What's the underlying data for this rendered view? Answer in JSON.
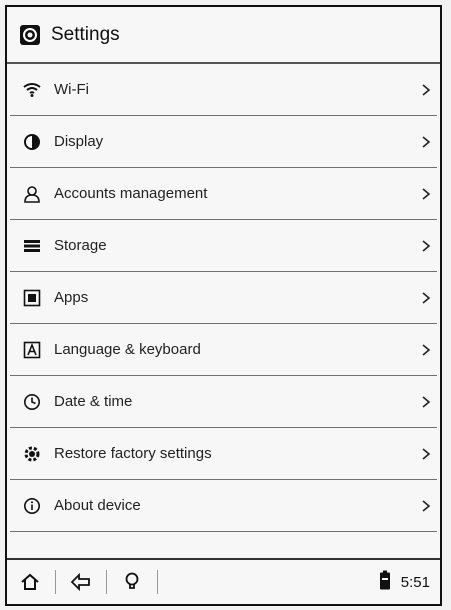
{
  "header": {
    "title": "Settings",
    "icon": "settings-app-icon"
  },
  "menu": [
    {
      "key": "wifi",
      "label": "Wi-Fi",
      "icon": "wifi-icon"
    },
    {
      "key": "display",
      "label": "Display",
      "icon": "contrast-icon"
    },
    {
      "key": "accounts",
      "label": "Accounts management",
      "icon": "user-icon"
    },
    {
      "key": "storage",
      "label": "Storage",
      "icon": "storage-icon"
    },
    {
      "key": "apps",
      "label": "Apps",
      "icon": "apps-icon"
    },
    {
      "key": "language",
      "label": "Language & keyboard",
      "icon": "keyboard-icon"
    },
    {
      "key": "datetime",
      "label": "Date & time",
      "icon": "clock-icon"
    },
    {
      "key": "restore",
      "label": "Restore factory settings",
      "icon": "restore-icon"
    },
    {
      "key": "about",
      "label": "About device",
      "icon": "info-icon"
    }
  ],
  "statusbar": {
    "time": "5:51"
  },
  "colors": {
    "line": "#707070",
    "text": "#1a1a1a",
    "background": "#f7f7f7"
  }
}
